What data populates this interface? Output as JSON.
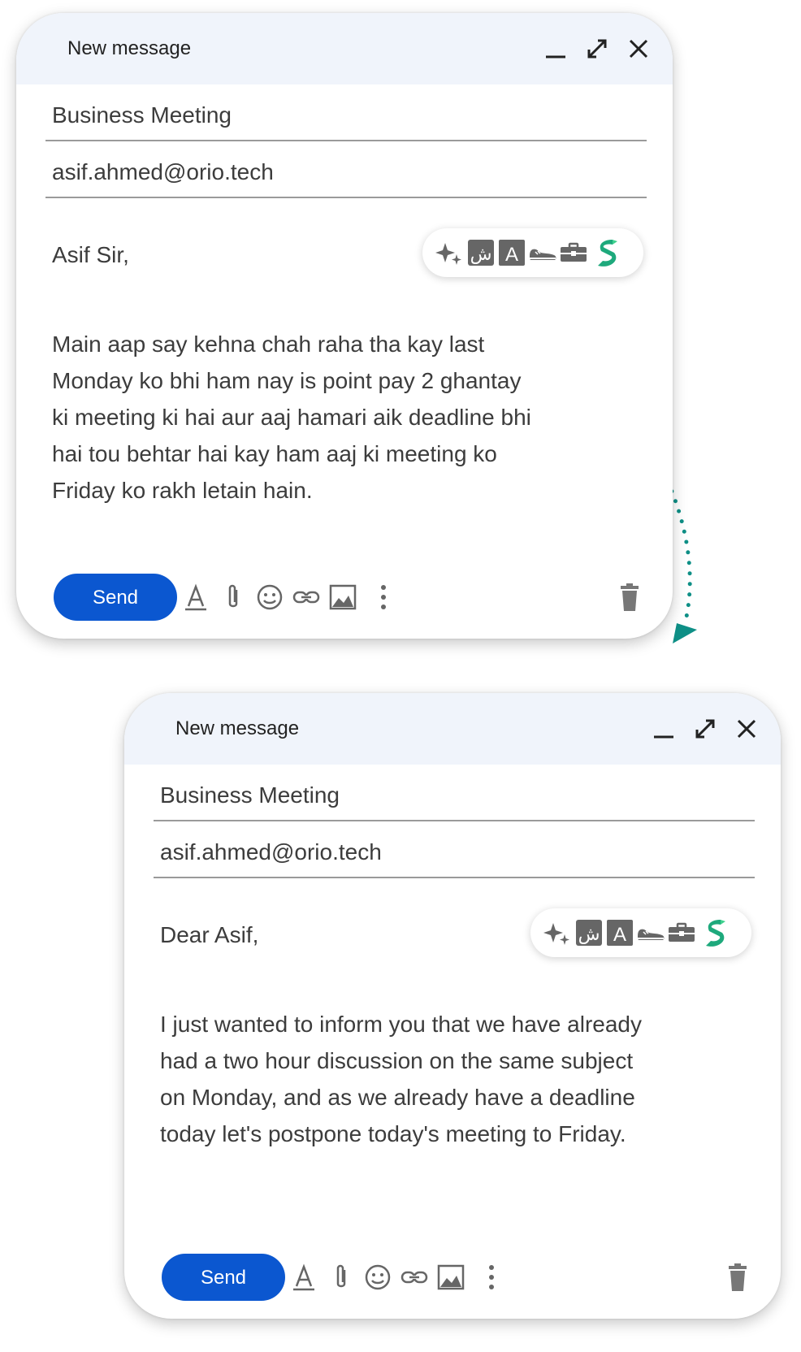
{
  "colors": {
    "accent": "#0b57d0",
    "header_bg": "#f0f4fb",
    "icon_gray": "#666666",
    "brand_green": "#1ea97c",
    "arrow_teal": "#0e8f86"
  },
  "windows": [
    {
      "title": "New message",
      "subject": "Business Meeting",
      "to": "asif.ahmed@orio.tech",
      "greeting": "Asif Sir,",
      "body": "Main aap say kehna chah raha tha kay last\nMonday ko bhi ham nay is point pay 2 ghantay\nki meeting ki hai aur aaj hamari aik deadline bhi\nhai tou behtar hai kay ham aaj ki meeting ko\nFriday ko rakh letain hain.",
      "send_label": "Send"
    },
    {
      "title": "New message",
      "subject": "Business Meeting",
      "to": "asif.ahmed@orio.tech",
      "greeting": "Dear Asif,",
      "body": "I just wanted to inform you that we have already\nhad a two hour discussion on the same subject\non Monday, and as we already have a deadline\ntoday let's postpone today's meeting to Friday.",
      "send_label": "Send"
    }
  ],
  "ai_toolbar": {
    "urdu_glyph": "ش",
    "translate_glyph": "A",
    "icons": [
      "sparkle-icon",
      "urdu-icon",
      "translate-icon",
      "casual-shoe-icon",
      "briefcase-icon",
      "brand-logo-icon"
    ]
  },
  "format_toolbar": {
    "icons": [
      "text-format-icon",
      "attach-icon",
      "emoji-icon",
      "link-icon",
      "image-icon",
      "more-icon",
      "trash-icon"
    ]
  }
}
